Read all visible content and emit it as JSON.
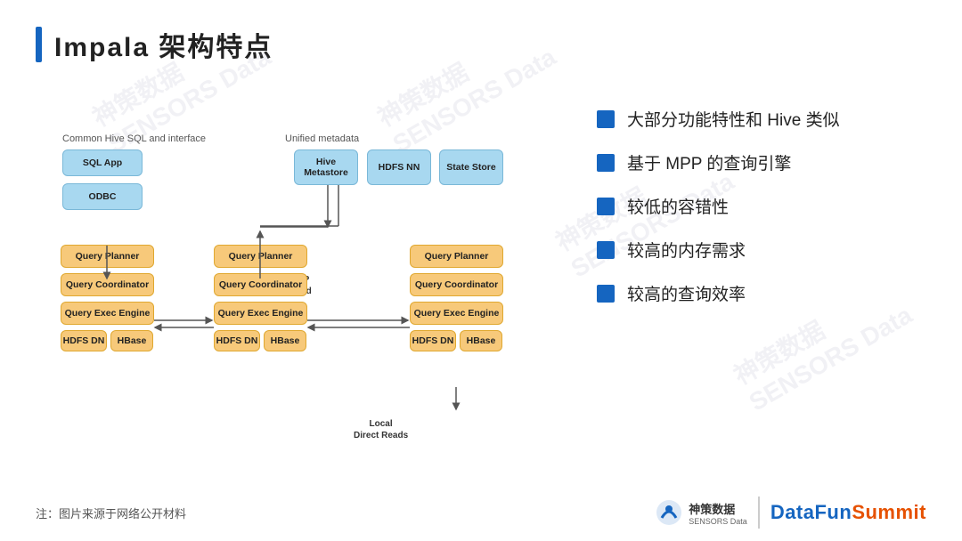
{
  "title": "Impala 架构特点",
  "watermarks": [
    "神策数据\nSENSORS Data",
    "神策数据\nSENSORS Data",
    "神策数据\nSENSORS Data",
    "神策数据\nSENSORS Data"
  ],
  "diagram": {
    "label_left": "Common Hive SQL and interface",
    "label_right": "Unified metadata",
    "label_mpp": "Fully MPP\nDistributed",
    "label_local": "Local\nDirect Reads",
    "nodes": {
      "sql_app": "SQL App",
      "odbc": "ODBC",
      "hive_metastore": "Hive\nMetastore",
      "hdfs_nn": "HDFS NN",
      "state_store": "State\nStore",
      "qp1": "Query Planner",
      "qc1": "Query Coordinator",
      "qe1": "Query Exec Engine",
      "hdfs_dn1": "HDFS DN",
      "hbase1": "HBase",
      "qp2": "Query Planner",
      "qc2": "Query Coordinator",
      "qe2": "Query Exec Engine",
      "hdfs_dn2": "HDFS DN",
      "hbase2": "HBase",
      "qp3": "Query Planner",
      "qc3": "Query Coordinator",
      "qe3": "Query Exec Engine",
      "hdfs_dn3": "HDFS DN",
      "hbase3": "HBase"
    }
  },
  "features": [
    "大部分功能特性和 Hive 类似",
    "基于 MPP 的查询引擎",
    "较低的容错性",
    "较高的内存需求",
    "较高的查询效率"
  ],
  "footer": {
    "note": "注：图片来源于网络公开材料",
    "brand_cn": "神策数据",
    "brand_sub": "SENSORS Data",
    "brand_en_part1": "DataFun",
    "brand_en_part2": "Summit"
  }
}
